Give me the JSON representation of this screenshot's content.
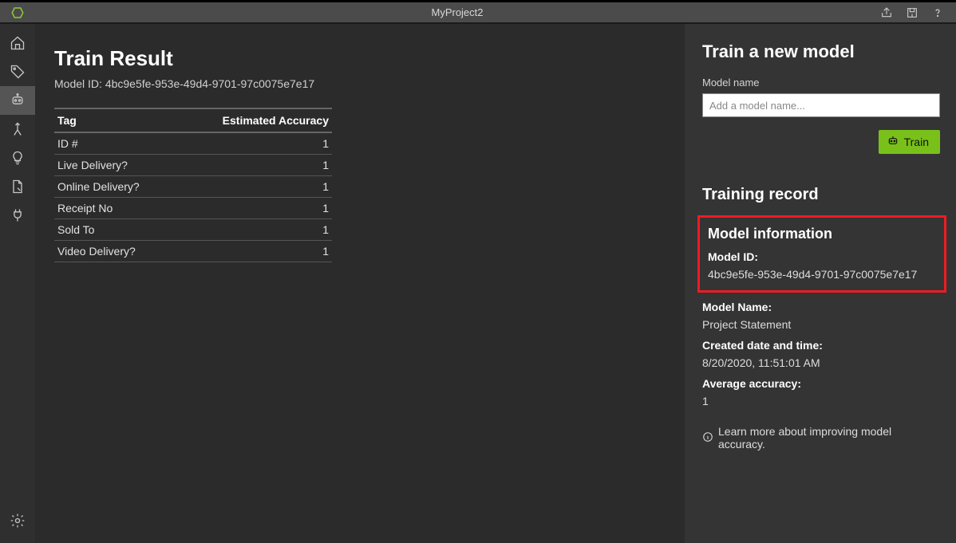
{
  "titlebar": {
    "project_name": "MyProject2"
  },
  "sidebar": {
    "icons": [
      "home",
      "tag",
      "robot",
      "merge",
      "bulb",
      "document",
      "plug",
      "settings"
    ],
    "active_index": 2
  },
  "main": {
    "title": "Train Result",
    "model_id_prefix": "Model ID: ",
    "model_id": "4bc9e5fe-953e-49d4-9701-97c0075e7e17",
    "table": {
      "columns": [
        "Tag",
        "Estimated Accuracy"
      ],
      "rows": [
        {
          "tag": "ID #",
          "acc": "1"
        },
        {
          "tag": "Live Delivery?",
          "acc": "1"
        },
        {
          "tag": "Online Delivery?",
          "acc": "1"
        },
        {
          "tag": "Receipt No",
          "acc": "1"
        },
        {
          "tag": "Sold To",
          "acc": "1"
        },
        {
          "tag": "Video Delivery?",
          "acc": "1"
        }
      ]
    }
  },
  "panel": {
    "train_heading": "Train a new model",
    "model_name_label": "Model name",
    "model_name_placeholder": "Add a model name...",
    "model_name_value": "",
    "train_button": "Train",
    "record_heading": "Training record",
    "model_info_heading": "Model information",
    "fields": {
      "model_id_label": "Model ID:",
      "model_id_value": "4bc9e5fe-953e-49d4-9701-97c0075e7e17",
      "model_name_label": "Model Name:",
      "model_name_value": "Project Statement",
      "created_label": "Created date and time:",
      "created_value": "8/20/2020, 11:51:01 AM",
      "avg_acc_label": "Average accuracy:",
      "avg_acc_value": "1"
    },
    "learn_more": "Learn more about improving model accuracy."
  },
  "colors": {
    "accent_green": "#79c11a",
    "highlight_red": "#ed1c24"
  }
}
